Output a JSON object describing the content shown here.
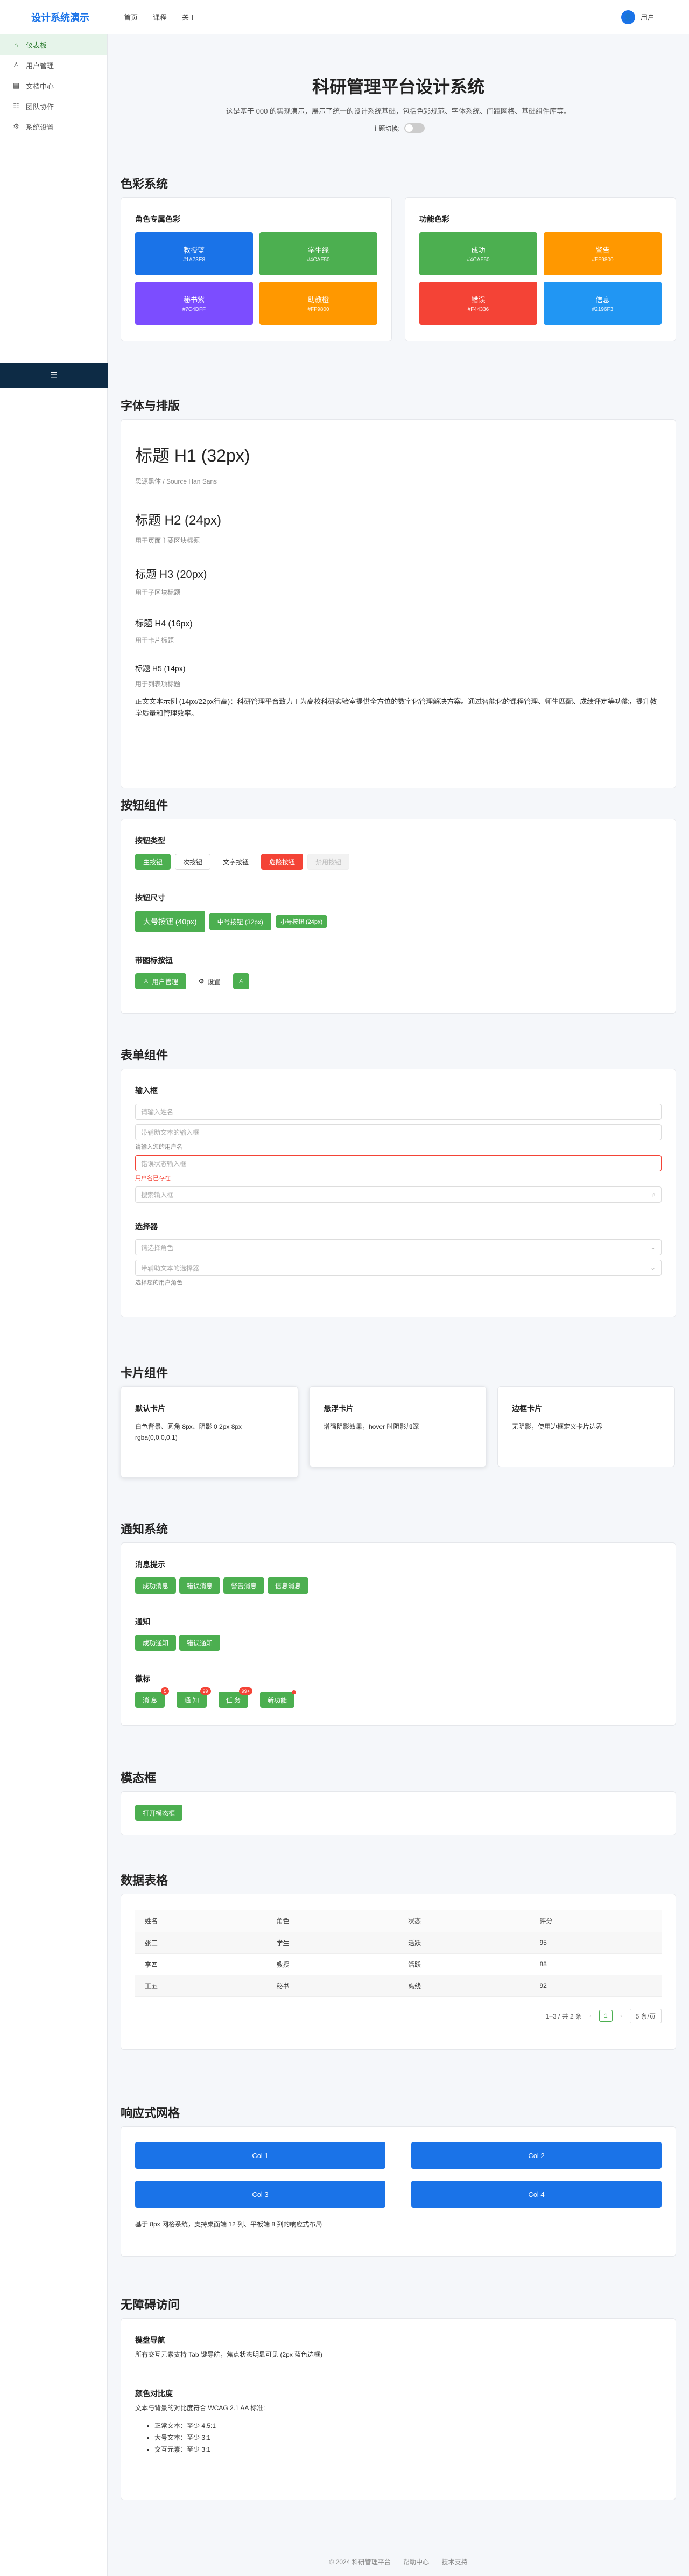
{
  "brand": "设计系统演示",
  "topnav": [
    "首页",
    "课程",
    "关于"
  ],
  "user": {
    "avatar": "👤",
    "name": "用户"
  },
  "sidebar": [
    {
      "icon": "⌂",
      "label": "仪表板"
    },
    {
      "icon": "♙",
      "label": "用户管理"
    },
    {
      "icon": "▤",
      "label": "文档中心"
    },
    {
      "icon": "☷",
      "label": "团队协作"
    },
    {
      "icon": "⚙",
      "label": "系统设置"
    }
  ],
  "collapse_icon": "☰",
  "hero": {
    "title": "科研管理平台设计系统",
    "desc": "这是基于 000 的实现演示，展示了统一的设计系统基础，包括色彩规范、字体系统、间距网格、基础组件库等。",
    "theme_label": "主题切换:"
  },
  "colors": {
    "title": "色彩系统",
    "role_title": "角色专属色彩",
    "func_title": "功能色彩",
    "role": [
      {
        "name": "教授蓝",
        "hex": "#1A73E8",
        "color": "#1a73e8"
      },
      {
        "name": "学生绿",
        "hex": "#4CAF50",
        "color": "#4caf50"
      },
      {
        "name": "秘书紫",
        "hex": "#7C4DFF",
        "color": "#7c4dff"
      },
      {
        "name": "助教橙",
        "hex": "#FF9800",
        "color": "#ff9800"
      }
    ],
    "func": [
      {
        "name": "成功",
        "hex": "#4CAF50",
        "color": "#4caf50"
      },
      {
        "name": "警告",
        "hex": "#FF9800",
        "color": "#ff9800"
      },
      {
        "name": "错误",
        "hex": "#F44336",
        "color": "#f44336"
      },
      {
        "name": "信息",
        "hex": "#2196F3",
        "color": "#2196f3"
      }
    ]
  },
  "typo": {
    "title": "字体与排版",
    "h1": "标题 H1 (32px)",
    "h1_note": "思源黑体 / Source Han Sans",
    "h2": "标题 H2 (24px)",
    "h2_note": "用于页面主要区块标题",
    "h3": "标题 H3 (20px)",
    "h3_note": "用于子区块标题",
    "h4": "标题 H4 (16px)",
    "h4_note": "用于卡片标题",
    "h5": "标题 H5 (14px)",
    "h5_note": "用于列表项标题",
    "body": "正文文本示例 (14px/22px行高)：科研管理平台致力于为高校科研实验室提供全方位的数字化管理解决方案。通过智能化的课程管理、师生匹配、成绩评定等功能，提升教学质量和管理效率。"
  },
  "buttons": {
    "title": "按钮组件",
    "type_title": "按钮类型",
    "types": [
      "主按钮",
      "次按钮",
      "文字按钮",
      "危险按钮",
      "禁用按钮"
    ],
    "size_title": "按钮尺寸",
    "sizes": [
      "大号按钮 (40px)",
      "中号按钮 (32px)",
      "小号按钮 (24px)"
    ],
    "icon_title": "带图标按钮",
    "icon_btn": "用户管理",
    "settings": "设置",
    "icon_user": "♙",
    "icon_gear": "⚙"
  },
  "forms": {
    "title": "表单组件",
    "input_title": "输入框",
    "ph1": "请输入姓名",
    "ph2": "带辅助文本的输入框",
    "hint": "请输入您的用户名",
    "ph3": "错误状态输入框",
    "err": "用户名已存在",
    "ph4": "搜索输入框",
    "search_icon": "⌕",
    "select_title": "选择器",
    "sel1": "请选择角色",
    "sel2": "带辅助文本的选择器",
    "sel_hint": "选择您的用户角色",
    "chevron": "⌄"
  },
  "cards": {
    "title": "卡片组件",
    "items": [
      {
        "title": "默认卡片",
        "text": "白色背景、圆角 8px、阴影 0 2px 8px rgba(0,0,0,0.1)"
      },
      {
        "title": "悬浮卡片",
        "text": "增强阴影效果，hover 时阴影加深"
      },
      {
        "title": "边框卡片",
        "text": "无阴影，使用边框定义卡片边界"
      }
    ]
  },
  "notify": {
    "title": "通知系统",
    "msg_title": "消息提示",
    "msgs": [
      {
        "label": "成功消息",
        "color": "#4caf50"
      },
      {
        "label": "错误消息",
        "color": "#4caf50"
      },
      {
        "label": "警告消息",
        "color": "#4caf50"
      },
      {
        "label": "信息消息",
        "color": "#4caf50"
      }
    ],
    "n_title": "通知",
    "notes": [
      "成功通知",
      "错误通知"
    ],
    "badge_title": "徽标",
    "badges": [
      {
        "label": "消 息",
        "count": "5"
      },
      {
        "label": "通 知",
        "count": "99"
      },
      {
        "label": "任 务",
        "count": "99+"
      },
      {
        "label": "新功能",
        "count": ""
      }
    ]
  },
  "modal": {
    "title": "模态框",
    "btn": "打开模态框"
  },
  "table": {
    "title": "数据表格",
    "headers": [
      "姓名",
      "角色",
      "状态",
      "评分"
    ],
    "rows": [
      [
        "张三",
        "学生",
        "活跃",
        "95"
      ],
      [
        "李四",
        "教授",
        "活跃",
        "88"
      ],
      [
        "王五",
        "秘书",
        "离线",
        "92"
      ]
    ],
    "summary": "1–3 / 共 2 条",
    "prev": "‹",
    "page": "1",
    "next": "›",
    "per": "5 条/页"
  },
  "grid": {
    "title": "响应式网格",
    "cols": [
      "Col 1",
      "Col 2",
      "Col 3",
      "Col 4"
    ],
    "note": "基于 8px 网格系统，支持桌面端 12 列、平板端 8 列的响应式布局"
  },
  "a11y": {
    "title": "无障碍访问",
    "kb_title": "键盘导航",
    "kb_text": "所有交互元素支持 Tab 键导航，焦点状态明显可见 (2px 蓝色边框)",
    "contrast_title": "颜色对比度",
    "contrast_text": "文本与背景的对比度符合 WCAG 2.1 AA 标准:",
    "items": [
      "正常文本：至少 4.5:1",
      "大号文本：至少 3:1",
      "交互元素：至少 3:1"
    ]
  },
  "footer": [
    "© 2024 科研管理平台",
    "帮助中心",
    "技术支持"
  ]
}
